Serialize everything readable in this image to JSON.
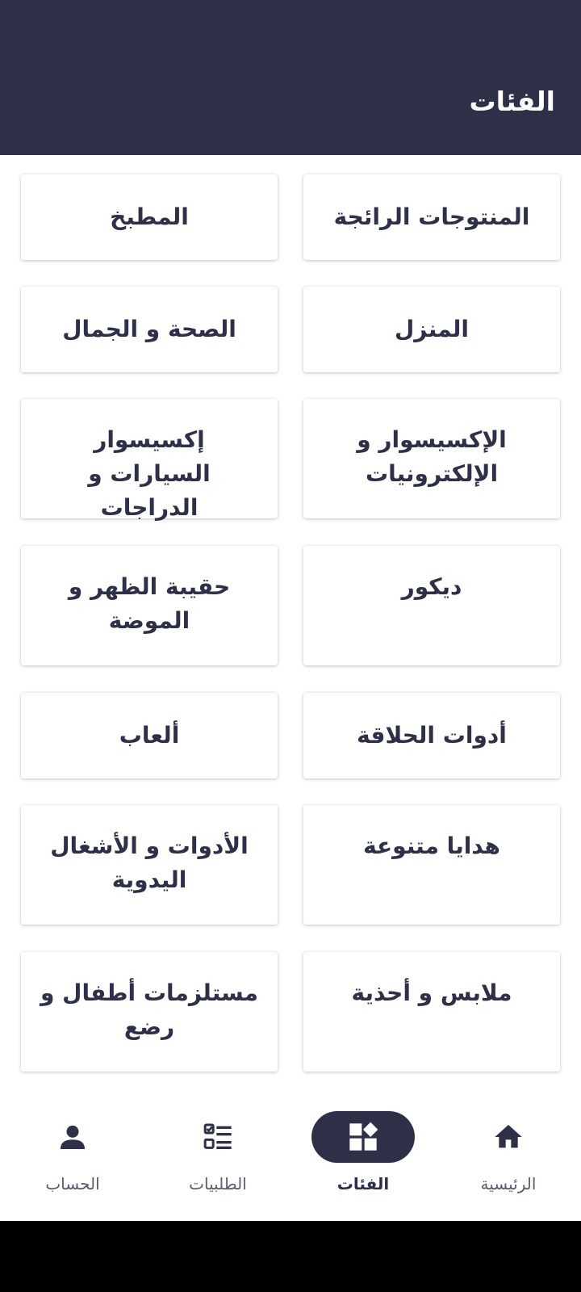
{
  "header": {
    "title": "الفئات"
  },
  "categories": [
    {
      "label": "المنتوجات الرائجة"
    },
    {
      "label": "المطبخ"
    },
    {
      "label": "المنزل"
    },
    {
      "label": "الصحة و الجمال"
    },
    {
      "label": "الإكسيسوار و الإلكترونيات"
    },
    {
      "label": "إكسيسوار السيارات و الدراجات"
    },
    {
      "label": "ديكور"
    },
    {
      "label": "حقيبة الظهر و الموضة"
    },
    {
      "label": "أدوات الحلاقة"
    },
    {
      "label": "ألعاب"
    },
    {
      "label": "هدايا متنوعة"
    },
    {
      "label": "الأدوات و الأشغال اليدوية"
    },
    {
      "label": "ملابس و أحذية"
    },
    {
      "label": "مستلزمات أطفال و رضع"
    }
  ],
  "bottom_nav": {
    "items": [
      {
        "label": "الرئيسية",
        "icon": "home-icon",
        "active": false
      },
      {
        "label": "الفئات",
        "icon": "categories-icon",
        "active": true
      },
      {
        "label": "الطلبيات",
        "icon": "checklist-icon",
        "active": false
      },
      {
        "label": "الحساب",
        "icon": "person-icon",
        "active": false
      }
    ]
  },
  "colors": {
    "primary": "#2d3047",
    "background": "#ffffff",
    "nav_inactive_text": "#5a5d6e"
  }
}
